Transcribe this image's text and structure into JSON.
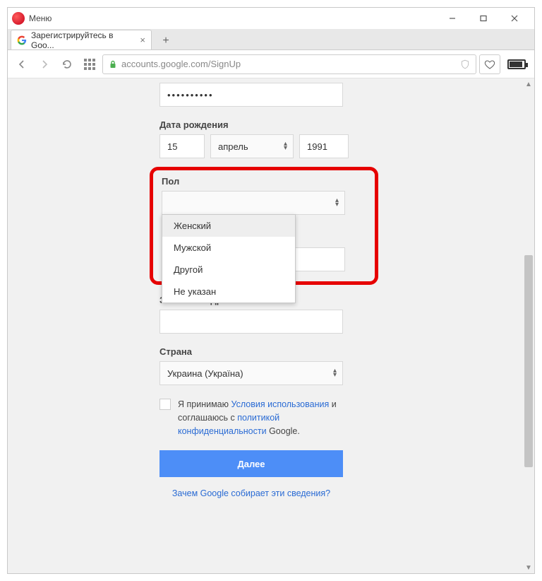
{
  "titlebar": {
    "menu": "Меню"
  },
  "tab": {
    "title": "Зарегистрируйтесь в Goo..."
  },
  "address": {
    "url_domain": "accounts.google.com",
    "url_path": "/SignUp"
  },
  "form": {
    "password_value": "••••••••••",
    "dob_label": "Дата рождения",
    "dob_day": "15",
    "dob_month": "апрель",
    "dob_year": "1991",
    "gender_label": "Пол",
    "gender_options": [
      "Женский",
      "Мужской",
      "Другой",
      "Не указан"
    ],
    "gender_selected_index": 0,
    "email_label": "Запасной адрес эл. почты",
    "country_label": "Страна",
    "country_value": "Украина (Україна)",
    "accept_prefix": "Я принимаю ",
    "tos": "Условия использования",
    "accept_mid": " и соглашаюсь с ",
    "privacy": "политикой конфиденциальности",
    "accept_suffix": " Google.",
    "next_btn": "Далее",
    "why_link": "Зачем Google собирает эти сведения?"
  }
}
